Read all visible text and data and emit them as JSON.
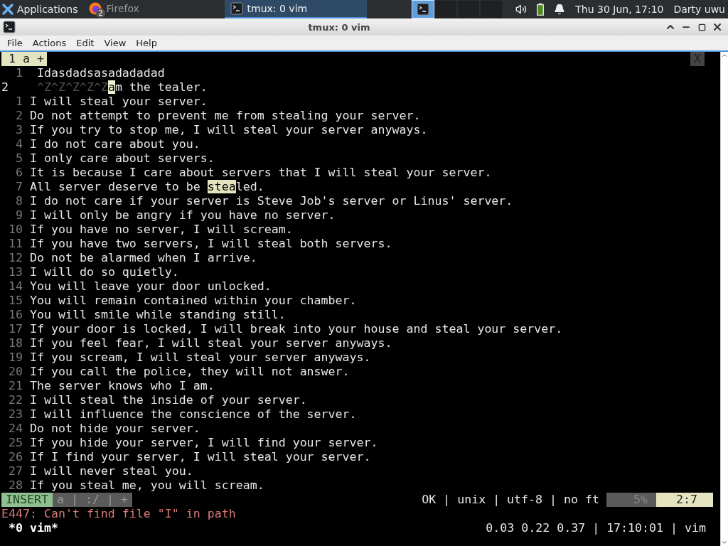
{
  "taskbar": {
    "menu_label": "Applications",
    "tasks": [
      {
        "kind": "firefox",
        "label": "Firefox",
        "badge": "2",
        "selected": false
      },
      {
        "kind": "terminal",
        "label": "tmux: 0 vim",
        "selected": true
      }
    ],
    "workspaces": [
      {
        "selected": true
      },
      {
        "selected": false
      },
      {
        "selected": false
      },
      {
        "selected": false
      }
    ],
    "clock": "Thu 30 Jun, 17:10",
    "user": "Darty uwu"
  },
  "window": {
    "title": "tmux: 0 vim"
  },
  "menu": [
    "File",
    "Actions",
    "Edit",
    "View",
    "Help"
  ],
  "vim": {
    "tabs": [
      {
        "label": "1 a +",
        "selected": true
      }
    ],
    "close_label": "X",
    "lines": [
      {
        "number": "1",
        "current": false,
        "segments": [
          {
            "kind": "plain",
            "text": " Idasdadsasadadadad"
          }
        ]
      },
      {
        "number": "2",
        "current": true,
        "segments": [
          {
            "kind": "control",
            "text": " ^Z^Z^Z^Z^Z"
          },
          {
            "kind": "cursor",
            "text": "a"
          },
          {
            "kind": "plain",
            "text": "m the tealer."
          }
        ]
      },
      {
        "number": "1",
        "current": false,
        "segments": [
          {
            "kind": "plain",
            "text": "I will steal your server."
          }
        ]
      },
      {
        "number": "2",
        "current": false,
        "segments": [
          {
            "kind": "plain",
            "text": "Do not attempt to prevent me from stealing your server."
          }
        ]
      },
      {
        "number": "3",
        "current": false,
        "segments": [
          {
            "kind": "plain",
            "text": "If you try to stop me, I will steal your server anyways."
          }
        ]
      },
      {
        "number": "4",
        "current": false,
        "segments": [
          {
            "kind": "plain",
            "text": "I do not care about you."
          }
        ]
      },
      {
        "number": "5",
        "current": false,
        "segments": [
          {
            "kind": "plain",
            "text": "I only care about servers."
          }
        ]
      },
      {
        "number": "6",
        "current": false,
        "segments": [
          {
            "kind": "plain",
            "text": "It is because I care about servers that I will steal your server."
          }
        ]
      },
      {
        "number": "7",
        "current": false,
        "segments": [
          {
            "kind": "plain",
            "text": "All server deserve to be "
          },
          {
            "kind": "match",
            "text": "stea"
          },
          {
            "kind": "plain",
            "text": "led."
          }
        ]
      },
      {
        "number": "8",
        "current": false,
        "segments": [
          {
            "kind": "plain",
            "text": "I do not care if your server is Steve Job's server or Linus' server."
          }
        ]
      },
      {
        "number": "9",
        "current": false,
        "segments": [
          {
            "kind": "plain",
            "text": "I will only be angry if you have no server."
          }
        ]
      },
      {
        "number": "10",
        "current": false,
        "segments": [
          {
            "kind": "plain",
            "text": "If you have no server, I will scream."
          }
        ]
      },
      {
        "number": "11",
        "current": false,
        "segments": [
          {
            "kind": "plain",
            "text": "If you have two servers, I will steal both servers."
          }
        ]
      },
      {
        "number": "12",
        "current": false,
        "segments": [
          {
            "kind": "plain",
            "text": "Do not be alarmed when I arrive."
          }
        ]
      },
      {
        "number": "13",
        "current": false,
        "segments": [
          {
            "kind": "plain",
            "text": "I will do so quietly."
          }
        ]
      },
      {
        "number": "14",
        "current": false,
        "segments": [
          {
            "kind": "plain",
            "text": "You will leave your door unlocked."
          }
        ]
      },
      {
        "number": "15",
        "current": false,
        "segments": [
          {
            "kind": "plain",
            "text": "You will remain contained within your chamber."
          }
        ]
      },
      {
        "number": "16",
        "current": false,
        "segments": [
          {
            "kind": "plain",
            "text": "You will smile while standing still."
          }
        ]
      },
      {
        "number": "17",
        "current": false,
        "segments": [
          {
            "kind": "plain",
            "text": "If your door is locked, I will break into your house and steal your server."
          }
        ]
      },
      {
        "number": "18",
        "current": false,
        "segments": [
          {
            "kind": "plain",
            "text": "If you feel fear, I will steal your server anyways."
          }
        ]
      },
      {
        "number": "19",
        "current": false,
        "segments": [
          {
            "kind": "plain",
            "text": "If you scream, I will steal your server anyways."
          }
        ]
      },
      {
        "number": "20",
        "current": false,
        "segments": [
          {
            "kind": "plain",
            "text": "If you call the police, they will not answer."
          }
        ]
      },
      {
        "number": "21",
        "current": false,
        "segments": [
          {
            "kind": "plain",
            "text": "The server knows who I am."
          }
        ]
      },
      {
        "number": "22",
        "current": false,
        "segments": [
          {
            "kind": "plain",
            "text": "I will steal the inside of your server."
          }
        ]
      },
      {
        "number": "23",
        "current": false,
        "segments": [
          {
            "kind": "plain",
            "text": "I will influence the conscience of the server."
          }
        ]
      },
      {
        "number": "24",
        "current": false,
        "segments": [
          {
            "kind": "plain",
            "text": "Do not hide your server."
          }
        ]
      },
      {
        "number": "25",
        "current": false,
        "segments": [
          {
            "kind": "plain",
            "text": "If you hide your server, I will find your server."
          }
        ]
      },
      {
        "number": "26",
        "current": false,
        "segments": [
          {
            "kind": "plain",
            "text": "If I find your server, I will steal your server."
          }
        ]
      },
      {
        "number": "27",
        "current": false,
        "segments": [
          {
            "kind": "plain",
            "text": "I will never steal you."
          }
        ]
      },
      {
        "number": "28",
        "current": false,
        "segments": [
          {
            "kind": "plain",
            "text": "If you steal me, you will scream."
          }
        ]
      }
    ],
    "statusline": {
      "mode": "INSERT",
      "info": "a | :/ | +",
      "fileinfo": "OK | unix | utf-8 | no ft",
      "percent": "5%",
      "position": "2:7"
    },
    "message": "E447: Can't find file \"I\" in path"
  },
  "tmux": {
    "window_label": "*0 vim*",
    "status_right": "0.03 0.22 0.37 | 17:10:01 | vim"
  }
}
